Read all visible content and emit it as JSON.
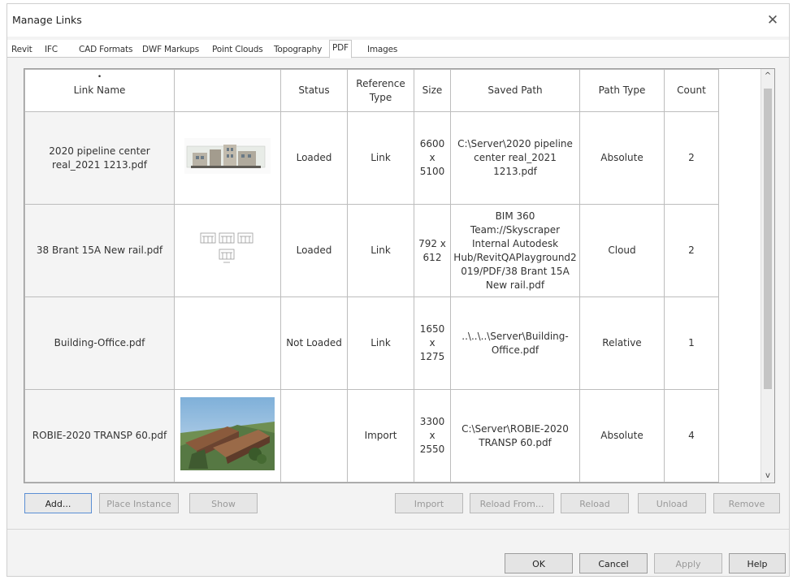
{
  "window": {
    "title": "Manage Links",
    "close_glyph": "✕"
  },
  "tabs": [
    {
      "label": "Revit"
    },
    {
      "label": "IFC"
    },
    {
      "label": "CAD Formats"
    },
    {
      "label": "DWF Markups"
    },
    {
      "label": "Point Clouds"
    },
    {
      "label": "Topography"
    },
    {
      "label": "PDF",
      "active": true
    },
    {
      "label": "Images"
    }
  ],
  "table": {
    "sort_indicator": "•",
    "columns": {
      "link_name": "Link Name",
      "preview": "",
      "status": "Status",
      "reference_type": "Reference Type",
      "size": "Size",
      "saved_path": "Saved Path",
      "path_type": "Path Type",
      "count": "Count"
    },
    "rows": [
      {
        "link_name": "2020 pipeline center real_2021 1213.pdf",
        "preview": "building-elevation-thumbnail",
        "status": "Loaded",
        "reference_type": "Link",
        "size": "6600 x 5100",
        "saved_path": "C:\\Server\\2020 pipeline center real_2021 1213.pdf",
        "path_type": "Absolute",
        "count": "2"
      },
      {
        "link_name": "38 Brant 15A New rail.pdf",
        "preview": "rail-details-thumbnail",
        "status": "Loaded",
        "reference_type": "Link",
        "size": "792 x 612",
        "saved_path": "BIM 360 Team://Skyscraper Internal Autodesk Hub/RevitQAPlayground2019/PDF/38 Brant 15A New rail.pdf",
        "path_type": "Cloud",
        "count": "2"
      },
      {
        "link_name": "Building-Office.pdf",
        "preview": "",
        "status": "Not Loaded",
        "reference_type": "Link",
        "size": "1650 x 1275",
        "saved_path": "..\\..\\..\\Server\\Building-Office.pdf",
        "path_type": "Relative",
        "count": "1"
      },
      {
        "link_name": "ROBIE-2020 TRANSP 60.pdf",
        "preview": "aerial-render-thumbnail",
        "status": "",
        "reference_type": "Import",
        "size": "3300 x 2550",
        "saved_path": "C:\\Server\\ROBIE-2020 TRANSP 60.pdf",
        "path_type": "Absolute",
        "count": "4"
      }
    ]
  },
  "scrollbar": {
    "up_glyph": "^",
    "down_glyph": "v"
  },
  "actions": {
    "add": "Add...",
    "place_instance": "Place Instance",
    "show": "Show",
    "import": "Import",
    "reload_from": "Reload From...",
    "reload": "Reload",
    "unload": "Unload",
    "remove": "Remove"
  },
  "footer": {
    "ok": "OK",
    "cancel": "Cancel",
    "apply": "Apply",
    "help": "Help"
  }
}
